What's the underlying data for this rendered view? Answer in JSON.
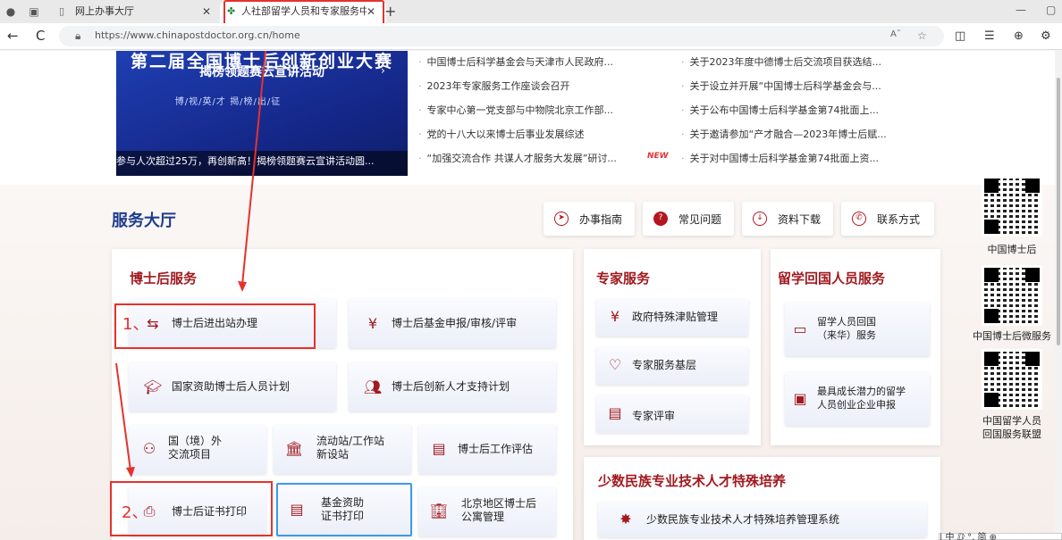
{
  "browser": {
    "tabs": [
      {
        "title": "网上办事大厅"
      },
      {
        "title": "人社部留学人员和专家服务中心F"
      }
    ],
    "new_tab": "+",
    "back": "←",
    "reload": "C",
    "url": "https://www.chinapostdoctor.org.cn/home",
    "reader": "Aˆ"
  },
  "banner": {
    "title": "第二届全国博士后创新创业大赛",
    "subtitle": "揭榜领题赛云宣讲活动",
    "motto": "博/视/英/才  揭/榜/出/征",
    "caption": "参与人次超过25万，再创新高！揭榜领题赛云宣讲活动圆..."
  },
  "news": {
    "left": [
      "中国博士后科学基金会与天津市人民政府...",
      "2023年专家服务工作座谈会召开",
      "专家中心第一党支部与中物院北京工作部...",
      "党的十八大以来博士后事业发展综述",
      "“加强交流合作 共谋人才服务大发展”研讨..."
    ],
    "right": [
      "关于2023年度中德博士后交流项目获选结...",
      "关于设立并开展“中国博士后科学基金会与...",
      "关于公布中国博士后科学基金第74批面上...",
      "关于邀请参加“产才融合—2023年博士后赋...",
      "关于对中国博士后科学基金第74批面上资..."
    ],
    "new_tag": "NEW"
  },
  "hall": {
    "title": "服务大厅",
    "quick": [
      "办事指南",
      "常见问题",
      "资料下载",
      "联系方式"
    ]
  },
  "postdoc": {
    "title": "博士后服务",
    "items": [
      "博士后进出站办理",
      "博士后基金申报/审核/评审",
      "国家资助博士后人员计划",
      "博士后创新人才支持计划",
      "国（境）外\n交流项目",
      "流动站/工作站\n新设站",
      "博士后工作评估",
      "博士后证书打印",
      "基金资助\n证书打印",
      "北京地区博士后\n公寓管理"
    ]
  },
  "expert": {
    "title": "专家服务",
    "items": [
      "政府特殊津贴管理",
      "专家服务基层",
      "专家评审"
    ]
  },
  "returnee": {
    "title": "留学回国人员服务",
    "items": [
      "留学人员回国\n（来华）服务",
      "最具成长潜力的留学\n人员创业企业申报"
    ]
  },
  "minority": {
    "title": "少数民族专业技术人才特殊培养",
    "items": [
      "少数民族专业技术人才特殊培养管理系统"
    ]
  },
  "qr": [
    "中国博士后",
    "中国博士后微服务",
    "中国留学人员\n回国服务联盟"
  ],
  "annotations": [
    "1、",
    "2、"
  ],
  "ime": "| 中  ⅅ  °,  简  ⊕"
}
